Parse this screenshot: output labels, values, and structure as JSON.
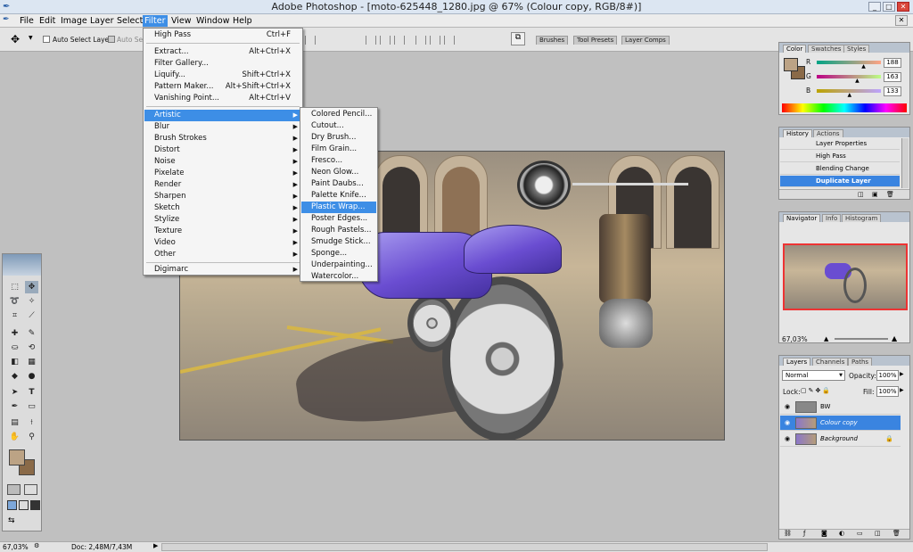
{
  "window": {
    "title": "Adobe Photoshop - [moto-625448_1280.jpg @ 67% (Colour copy, RGB/8#)]",
    "controls": [
      "_",
      "□",
      "✕"
    ],
    "icon": "photoshop-feather-icon"
  },
  "menubar": {
    "items": [
      "File",
      "Edit",
      "Image",
      "Layer",
      "Select",
      "Filter",
      "View",
      "Window",
      "Help"
    ],
    "active": "Filter",
    "doc_close": "✕"
  },
  "options": {
    "auto_select_layer": "Auto Select Layer",
    "auto_select_clip": "Auto Sel",
    "workspace_tabs": [
      "Brushes",
      "Tool Presets",
      "Layer Comps"
    ]
  },
  "filter_menu": {
    "items": [
      {
        "label": "High Pass",
        "shortcut": "Ctrl+F"
      },
      {
        "label": "Extract...",
        "shortcut": "Alt+Ctrl+X"
      },
      {
        "label": "Filter Gallery...",
        "shortcut": ""
      },
      {
        "label": "Liquify...",
        "shortcut": "Shift+Ctrl+X"
      },
      {
        "label": "Pattern Maker...",
        "shortcut": "Alt+Shift+Ctrl+X"
      },
      {
        "label": "Vanishing Point...",
        "shortcut": "Alt+Ctrl+V"
      },
      {
        "label": "Artistic",
        "shortcut": ""
      },
      {
        "label": "Blur",
        "shortcut": ""
      },
      {
        "label": "Brush Strokes",
        "shortcut": ""
      },
      {
        "label": "Distort",
        "shortcut": ""
      },
      {
        "label": "Noise",
        "shortcut": ""
      },
      {
        "label": "Pixelate",
        "shortcut": ""
      },
      {
        "label": "Render",
        "shortcut": ""
      },
      {
        "label": "Sharpen",
        "shortcut": ""
      },
      {
        "label": "Sketch",
        "shortcut": ""
      },
      {
        "label": "Stylize",
        "shortcut": ""
      },
      {
        "label": "Texture",
        "shortcut": ""
      },
      {
        "label": "Video",
        "shortcut": ""
      },
      {
        "label": "Other",
        "shortcut": ""
      },
      {
        "label": "Digimarc",
        "shortcut": ""
      }
    ],
    "highlighted": "Artistic"
  },
  "artistic_submenu": {
    "items": [
      "Colored Pencil...",
      "Cutout...",
      "Dry Brush...",
      "Film Grain...",
      "Fresco...",
      "Neon Glow...",
      "Paint Daubs...",
      "Palette Knife...",
      "Plastic Wrap...",
      "Poster Edges...",
      "Rough Pastels...",
      "Smudge Stick...",
      "Sponge...",
      "Underpainting...",
      "Watercolor..."
    ],
    "highlighted": "Plastic Wrap..."
  },
  "color_panel": {
    "tabs": [
      "Color",
      "Swatches",
      "Styles"
    ],
    "r_label": "R",
    "g_label": "G",
    "b_label": "B",
    "r": "188",
    "g": "163",
    "b": "133",
    "r_frac": 0.74,
    "g_frac": 0.64,
    "b_frac": 0.52,
    "foreground": "#bca385"
  },
  "history_panel": {
    "tabs": [
      "History",
      "Actions"
    ],
    "items": [
      "Layer Properties",
      "High Pass",
      "Blending Change",
      "Duplicate Layer"
    ],
    "selected": "Duplicate Layer"
  },
  "navigator_panel": {
    "tabs": [
      "Navigator",
      "Info",
      "Histogram"
    ],
    "zoom": "67,03%"
  },
  "layers_panel": {
    "tabs": [
      "Layers",
      "Channels",
      "Paths"
    ],
    "blend_mode": "Normal",
    "opacity_label": "Opacity:",
    "opacity": "100%",
    "lock_label": "Lock:",
    "fill_label": "Fill:",
    "fill": "100%",
    "layers": [
      "BW",
      "Colour copy",
      "Background"
    ],
    "selected": "Colour copy"
  },
  "status": {
    "zoom": "67,03%",
    "doc": "Doc: 2,48M/7,43M"
  },
  "colors": {
    "accent": "#3d8ee6",
    "selection": "#3a84e0"
  }
}
